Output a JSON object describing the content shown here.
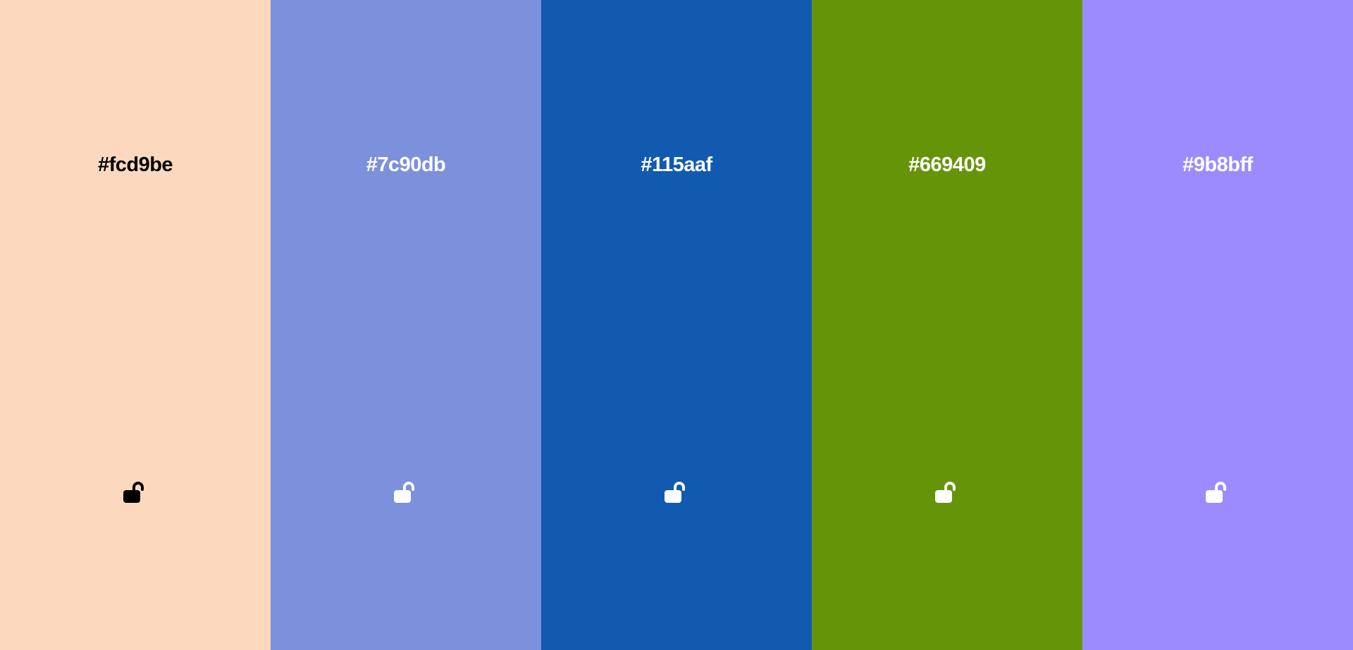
{
  "palette": {
    "swatches": [
      {
        "hex": "#fcd9be",
        "text_color": "#000000",
        "lock_state": "unlocked",
        "lock_icon": "lock-open-icon"
      },
      {
        "hex": "#7c90db",
        "text_color": "#ffffff",
        "lock_state": "unlocked",
        "lock_icon": "lock-open-icon"
      },
      {
        "hex": "#115aaf",
        "text_color": "#ffffff",
        "lock_state": "unlocked",
        "lock_icon": "lock-open-icon"
      },
      {
        "hex": "#669409",
        "text_color": "#ffffff",
        "lock_state": "unlocked",
        "lock_icon": "lock-open-icon"
      },
      {
        "hex": "#9b8bff",
        "text_color": "#ffffff",
        "lock_state": "unlocked",
        "lock_icon": "lock-open-icon"
      }
    ]
  }
}
